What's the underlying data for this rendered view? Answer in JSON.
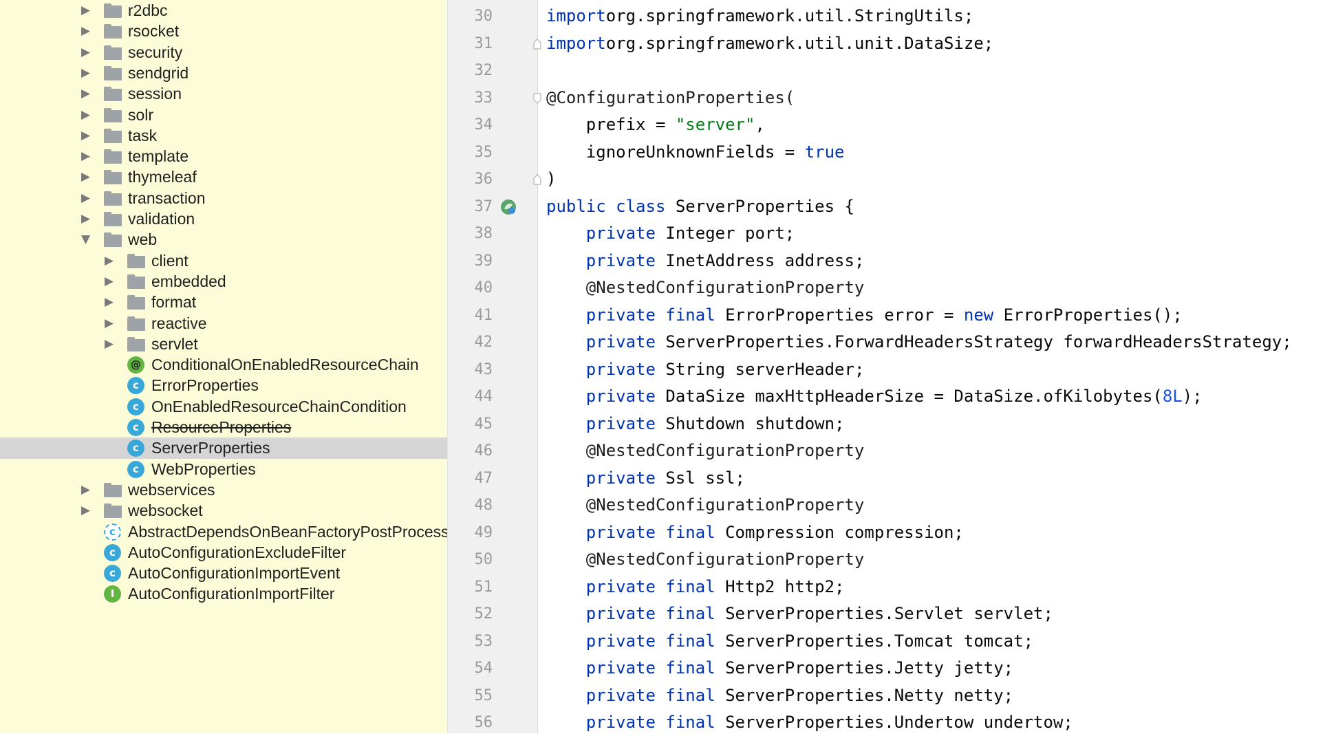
{
  "tree": [
    {
      "label": "r2dbc",
      "kind": "folder",
      "depth": 0,
      "arrow": "collapsed"
    },
    {
      "label": "rsocket",
      "kind": "folder",
      "depth": 0,
      "arrow": "collapsed"
    },
    {
      "label": "security",
      "kind": "folder",
      "depth": 0,
      "arrow": "collapsed"
    },
    {
      "label": "sendgrid",
      "kind": "folder",
      "depth": 0,
      "arrow": "collapsed"
    },
    {
      "label": "session",
      "kind": "folder",
      "depth": 0,
      "arrow": "collapsed"
    },
    {
      "label": "solr",
      "kind": "folder",
      "depth": 0,
      "arrow": "collapsed"
    },
    {
      "label": "task",
      "kind": "folder",
      "depth": 0,
      "arrow": "collapsed"
    },
    {
      "label": "template",
      "kind": "folder",
      "depth": 0,
      "arrow": "collapsed"
    },
    {
      "label": "thymeleaf",
      "kind": "folder",
      "depth": 0,
      "arrow": "collapsed"
    },
    {
      "label": "transaction",
      "kind": "folder",
      "depth": 0,
      "arrow": "collapsed"
    },
    {
      "label": "validation",
      "kind": "folder",
      "depth": 0,
      "arrow": "collapsed"
    },
    {
      "label": "web",
      "kind": "folder",
      "depth": 0,
      "arrow": "expanded"
    },
    {
      "label": "client",
      "kind": "folder",
      "depth": 1,
      "arrow": "collapsed"
    },
    {
      "label": "embedded",
      "kind": "folder",
      "depth": 1,
      "arrow": "collapsed"
    },
    {
      "label": "format",
      "kind": "folder",
      "depth": 1,
      "arrow": "collapsed"
    },
    {
      "label": "reactive",
      "kind": "folder",
      "depth": 1,
      "arrow": "collapsed"
    },
    {
      "label": "servlet",
      "kind": "folder",
      "depth": 1,
      "arrow": "collapsed"
    },
    {
      "label": "ConditionalOnEnabledResourceChain",
      "kind": "annotation",
      "depth": 1,
      "icon_text": "@"
    },
    {
      "label": "ErrorProperties",
      "kind": "class",
      "depth": 1,
      "icon_text": "c"
    },
    {
      "label": "OnEnabledResourceChainCondition",
      "kind": "class",
      "depth": 1,
      "icon_text": "c"
    },
    {
      "label": "ResourceProperties",
      "kind": "class",
      "depth": 1,
      "icon_text": "c",
      "deprecated": true
    },
    {
      "label": "ServerProperties",
      "kind": "class",
      "depth": 1,
      "icon_text": "c",
      "selected": true
    },
    {
      "label": "WebProperties",
      "kind": "class",
      "depth": 1,
      "icon_text": "c"
    },
    {
      "label": "webservices",
      "kind": "folder",
      "depth": 0,
      "arrow": "collapsed"
    },
    {
      "label": "websocket",
      "kind": "folder",
      "depth": 0,
      "arrow": "collapsed"
    },
    {
      "label": "AbstractDependsOnBeanFactoryPostProcessor",
      "kind": "abstract",
      "depth": 0,
      "icon_text": "c"
    },
    {
      "label": "AutoConfigurationExcludeFilter",
      "kind": "class",
      "depth": 0,
      "icon_text": "c"
    },
    {
      "label": "AutoConfigurationImportEvent",
      "kind": "class",
      "depth": 0,
      "icon_text": "c"
    },
    {
      "label": "AutoConfigurationImportFilter",
      "kind": "interface",
      "depth": 0,
      "icon_text": "I"
    }
  ],
  "editor": {
    "lines": [
      {
        "n": "30",
        "tokens": [
          [
            "kw",
            "import"
          ],
          [
            "",
            "org.springframework.util.StringUtils;"
          ]
        ]
      },
      {
        "n": "31",
        "fold": "end",
        "tokens": [
          [
            "kw",
            "import"
          ],
          [
            "",
            "org.springframework.util.unit.DataSize;"
          ]
        ]
      },
      {
        "n": "32",
        "tokens": []
      },
      {
        "n": "33",
        "fold": "start",
        "tokens": [
          [
            "ann",
            "@ConfigurationProperties("
          ]
        ]
      },
      {
        "n": "34",
        "tokens": [
          [
            "",
            "    prefix = "
          ],
          [
            "str",
            "\"server\""
          ],
          [
            "",
            ","
          ]
        ]
      },
      {
        "n": "35",
        "tokens": [
          [
            "",
            "    ignoreUnknownFields = "
          ],
          [
            "kw",
            "true"
          ]
        ]
      },
      {
        "n": "36",
        "fold": "end",
        "tokens": [
          [
            "",
            ")"
          ]
        ]
      },
      {
        "n": "37",
        "gutter_icon": "spring-bean-icon",
        "tokens": [
          [
            "kw",
            "public class"
          ],
          [
            "",
            " ServerProperties {"
          ]
        ]
      },
      {
        "n": "38",
        "tokens": [
          [
            "",
            "    "
          ],
          [
            "kw",
            "private"
          ],
          [
            "",
            " Integer port;"
          ]
        ]
      },
      {
        "n": "39",
        "tokens": [
          [
            "",
            "    "
          ],
          [
            "kw",
            "private"
          ],
          [
            "",
            " InetAddress address;"
          ]
        ]
      },
      {
        "n": "40",
        "tokens": [
          [
            "ann",
            "    @NestedConfigurationProperty"
          ]
        ]
      },
      {
        "n": "41",
        "tokens": [
          [
            "",
            "    "
          ],
          [
            "kw",
            "private final"
          ],
          [
            "",
            " ErrorProperties error = "
          ],
          [
            "kw",
            "new"
          ],
          [
            "",
            " ErrorProperties();"
          ]
        ]
      },
      {
        "n": "42",
        "tokens": [
          [
            "",
            "    "
          ],
          [
            "kw",
            "private"
          ],
          [
            "",
            " ServerProperties.ForwardHeadersStrategy forwardHeadersStrategy;"
          ]
        ]
      },
      {
        "n": "43",
        "tokens": [
          [
            "",
            "    "
          ],
          [
            "kw",
            "private"
          ],
          [
            "",
            " String serverHeader;"
          ]
        ]
      },
      {
        "n": "44",
        "tokens": [
          [
            "",
            "    "
          ],
          [
            "kw",
            "private"
          ],
          [
            "",
            " DataSize maxHttpHeaderSize = DataSize.ofKilobytes("
          ],
          [
            "num",
            "8L"
          ],
          [
            "",
            ");"
          ]
        ]
      },
      {
        "n": "45",
        "tokens": [
          [
            "",
            "    "
          ],
          [
            "kw",
            "private"
          ],
          [
            "",
            " Shutdown shutdown;"
          ]
        ]
      },
      {
        "n": "46",
        "tokens": [
          [
            "ann",
            "    @NestedConfigurationProperty"
          ]
        ]
      },
      {
        "n": "47",
        "tokens": [
          [
            "",
            "    "
          ],
          [
            "kw",
            "private"
          ],
          [
            "",
            " Ssl ssl;"
          ]
        ]
      },
      {
        "n": "48",
        "tokens": [
          [
            "ann",
            "    @NestedConfigurationProperty"
          ]
        ]
      },
      {
        "n": "49",
        "tokens": [
          [
            "",
            "    "
          ],
          [
            "kw",
            "private final"
          ],
          [
            "",
            " Compression compression;"
          ]
        ]
      },
      {
        "n": "50",
        "tokens": [
          [
            "ann",
            "    @NestedConfigurationProperty"
          ]
        ]
      },
      {
        "n": "51",
        "tokens": [
          [
            "",
            "    "
          ],
          [
            "kw",
            "private final"
          ],
          [
            "",
            " Http2 http2;"
          ]
        ]
      },
      {
        "n": "52",
        "tokens": [
          [
            "",
            "    "
          ],
          [
            "kw",
            "private final"
          ],
          [
            "",
            " ServerProperties.Servlet servlet;"
          ]
        ]
      },
      {
        "n": "53",
        "tokens": [
          [
            "",
            "    "
          ],
          [
            "kw",
            "private final"
          ],
          [
            "",
            " ServerProperties.Tomcat tomcat;"
          ]
        ]
      },
      {
        "n": "54",
        "tokens": [
          [
            "",
            "    "
          ],
          [
            "kw",
            "private final"
          ],
          [
            "",
            " ServerProperties.Jetty jetty;"
          ]
        ]
      },
      {
        "n": "55",
        "tokens": [
          [
            "",
            "    "
          ],
          [
            "kw",
            "private final"
          ],
          [
            "",
            " ServerProperties.Netty netty;"
          ]
        ]
      },
      {
        "n": "56",
        "tokens": [
          [
            "",
            "    "
          ],
          [
            "kw",
            "private final"
          ],
          [
            "",
            " ServerProperties.Undertow undertow;"
          ]
        ]
      }
    ]
  }
}
